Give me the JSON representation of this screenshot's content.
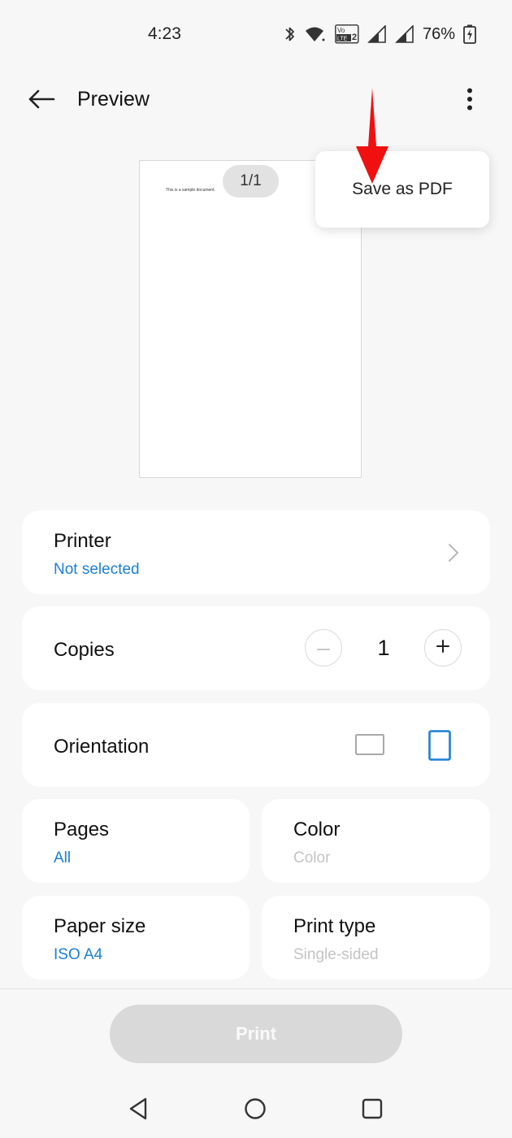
{
  "status_bar": {
    "time": "4:23",
    "battery": "76%",
    "icons": [
      "bluetooth-icon",
      "wifi-icon",
      "volte-icon",
      "signal-icon",
      "signal-roaming-icon",
      "battery-charging-icon"
    ],
    "volte_text": "Vo LTE2"
  },
  "app_bar": {
    "title": "Preview",
    "back_icon": "arrow-back-icon",
    "more_icon": "more-vertical-icon"
  },
  "preview": {
    "document_text": "This is a sample document.",
    "page_counter": "1/1"
  },
  "menu": {
    "items": [
      {
        "label": "Save as PDF"
      }
    ]
  },
  "settings": {
    "printer": {
      "title": "Printer",
      "value": "Not selected"
    },
    "copies": {
      "title": "Copies",
      "value": "1"
    },
    "orientation": {
      "title": "Orientation",
      "selected": "portrait"
    },
    "pages": {
      "title": "Pages",
      "value": "All"
    },
    "color": {
      "title": "Color",
      "value": "Color"
    },
    "paper_size": {
      "title": "Paper size",
      "value": "ISO A4"
    },
    "print_type": {
      "title": "Print type",
      "value": "Single-sided"
    }
  },
  "actions": {
    "print_label": "Print"
  },
  "colors": {
    "accent_blue": "#1c7fd6",
    "annotation_red": "#f01010",
    "disabled_button": "#d9d9d9"
  }
}
